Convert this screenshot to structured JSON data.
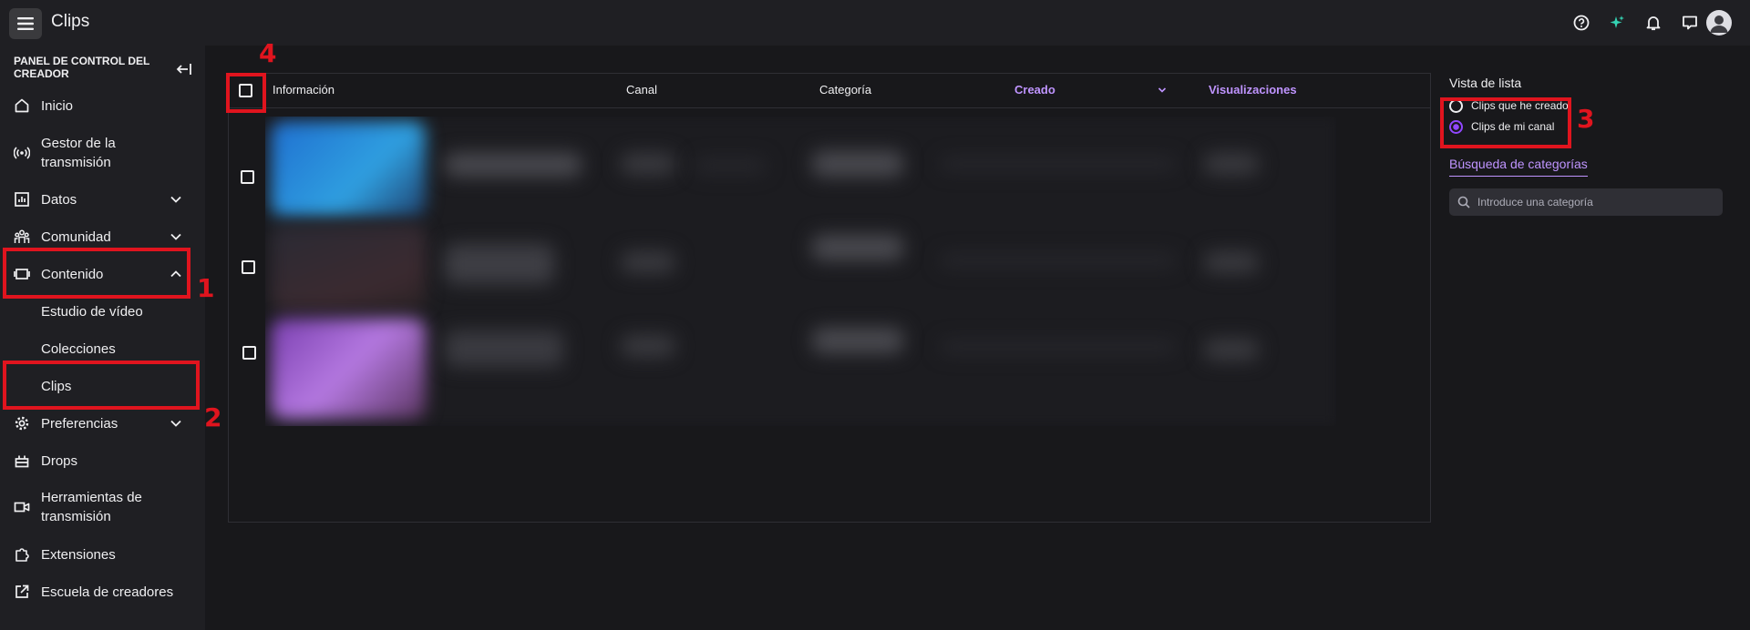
{
  "header": {
    "title": "Clips",
    "icons": [
      "menu-icon",
      "help-icon",
      "sparkle-icon",
      "bell-icon",
      "messages-icon",
      "avatar"
    ]
  },
  "sidebar": {
    "panel_title": "PANEL DE CONTROL DEL CREADOR",
    "items": [
      {
        "label": "Inicio",
        "icon": "home-icon"
      },
      {
        "label": "Gestor de la transmisión",
        "icon": "broadcast-icon"
      },
      {
        "label": "Datos",
        "icon": "chart-icon",
        "expandable": true
      },
      {
        "label": "Comunidad",
        "icon": "community-icon",
        "expandable": true
      },
      {
        "label": "Contenido",
        "icon": "content-icon",
        "expanded": true
      },
      {
        "label": "Preferencias",
        "icon": "gear-icon",
        "expandable": true
      },
      {
        "label": "Drops",
        "icon": "drops-icon"
      },
      {
        "label": "Herramientas de transmisión",
        "icon": "camera-icon"
      },
      {
        "label": "Extensiones",
        "icon": "puzzle-icon"
      },
      {
        "label": "Escuela de creadores",
        "icon": "external-link-icon"
      }
    ],
    "sub_items": [
      "Estudio de vídeo",
      "Colecciones",
      "Clips"
    ]
  },
  "table": {
    "columns": [
      "Información",
      "Canal",
      "Categoría",
      "Creado",
      "Visualizaciones"
    ],
    "sorted_column": "Creado",
    "rows": 3
  },
  "right_panel": {
    "title": "Vista de lista",
    "options": [
      {
        "label": "Clips que he creado",
        "selected": false
      },
      {
        "label": "Clips de mi canal",
        "selected": true
      }
    ],
    "category_search_link": "Búsqueda de categorías",
    "search_placeholder": "Introduce una categoría"
  },
  "annotations": [
    "1",
    "2",
    "3",
    "4"
  ],
  "colors": {
    "accent": "#bf94ff",
    "annotation": "#e0141e",
    "background": "#18181b"
  }
}
